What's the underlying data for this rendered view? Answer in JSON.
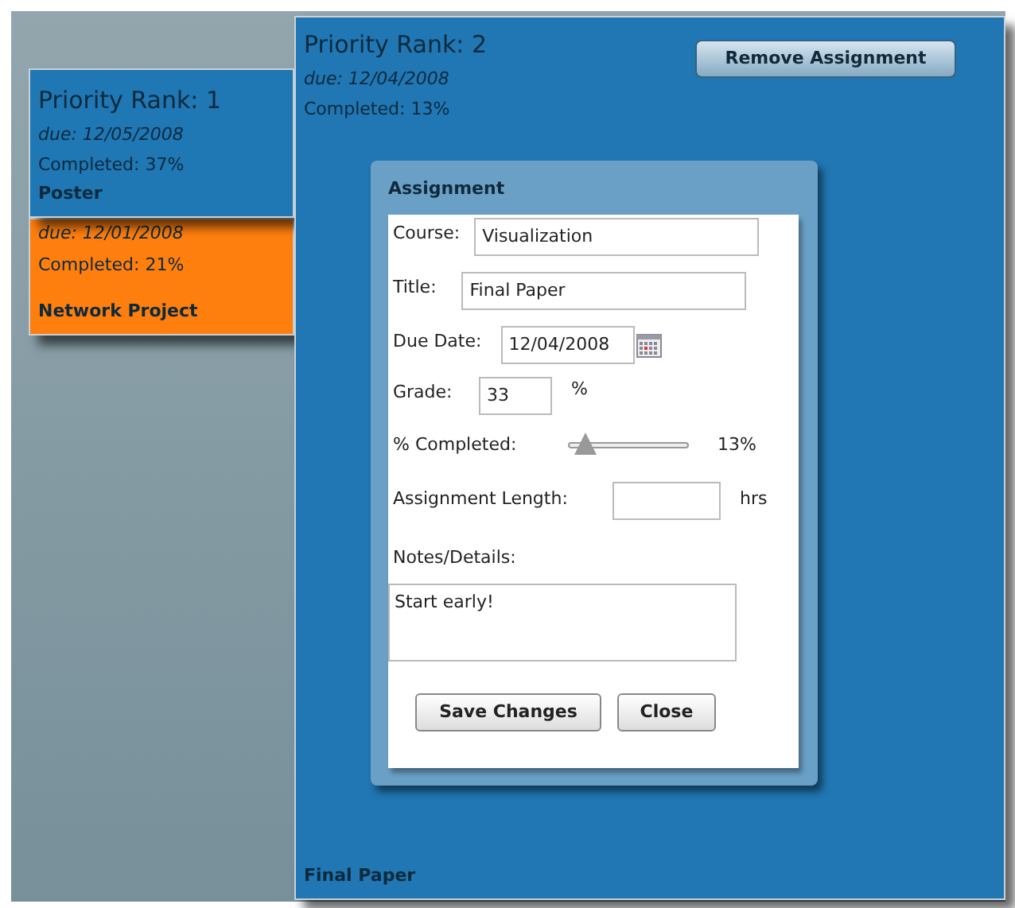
{
  "cards": [
    {
      "color": "#1f77b4",
      "rank": "Priority Rank: 1",
      "due": "due: 12/05/2008",
      "completed": "Completed: 37%",
      "title": "Poster"
    },
    {
      "color": "#ff7f0e",
      "due": "due: 12/01/2008",
      "completed": "Completed: 21%",
      "title": "Network Project"
    }
  ],
  "detail": {
    "rank": "Priority Rank: 2",
    "due": "due: 12/04/2008",
    "completed": "Completed: 13%",
    "remove_button": "Remove Assignment",
    "title": "Final Paper",
    "dialog": {
      "title": "Assignment",
      "course_label": "Course:",
      "course": "Visualization",
      "title_label": "Title:",
      "title_value": "Final Paper",
      "due_label": "Due Date:",
      "due_value": "12/04/2008",
      "grade_label": "Grade:",
      "grade": "33",
      "grade_unit": "%",
      "completed_label": "% Completed:",
      "completed_slider": {
        "level": 0.13
      },
      "completed_reading": "13%",
      "length_label": "Assignment Length:",
      "length_unit": "hrs",
      "notes_label": "Notes/Details:",
      "notes": "Start early!",
      "buttons": [
        "Save Changes",
        "Close"
      ]
    }
  }
}
